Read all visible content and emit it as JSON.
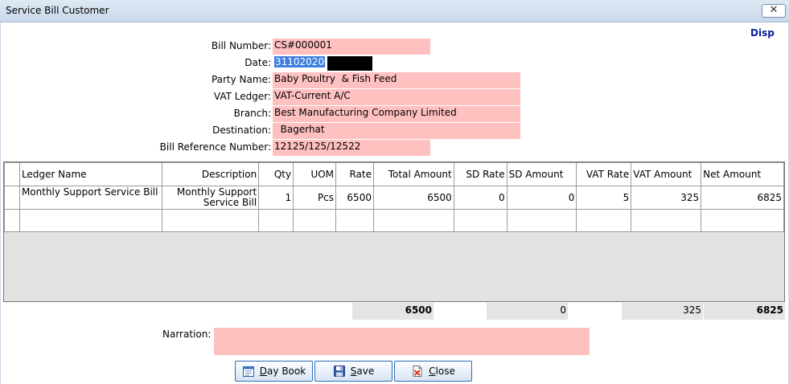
{
  "window": {
    "title": "Service Bill Customer",
    "close_glyph": "✕"
  },
  "disp": "Disp",
  "fields": {
    "bill_number": {
      "label": "Bill Number:",
      "value": "CS#000001"
    },
    "date": {
      "label": "Date:",
      "value": "31102020"
    },
    "party_name": {
      "label": "Party Name:",
      "value": "Baby Poultry  & Fish Feed"
    },
    "vat_ledger": {
      "label": "VAT Ledger:",
      "value": "VAT-Current A/C"
    },
    "branch": {
      "label": "Branch:",
      "value": "Best Manufacturing Company Limited"
    },
    "destination": {
      "label": "Destination:",
      "value": "  Bagerhat"
    },
    "bill_reference": {
      "label": "Bill Reference Number:",
      "value": "12125/125/12522"
    }
  },
  "grid": {
    "headers": [
      "Ledger Name",
      "Description",
      "Qty",
      "UOM",
      "Rate",
      "Total Amount",
      "SD Rate",
      "SD Amount",
      "VAT Rate",
      "VAT Amount",
      "Net Amount"
    ],
    "rows": [
      [
        "Monthly Support Service Bill",
        "Monthly Support Service Bill",
        "1",
        "Pcs",
        "6500",
        "6500",
        "0",
        "0",
        "5",
        "325",
        "6825"
      ]
    ]
  },
  "totals": {
    "total_amount": "6500",
    "sd_amount": "0",
    "vat_amount": "325",
    "net_amount": "6825"
  },
  "narration": {
    "label": "Narration:",
    "value": ""
  },
  "buttons": {
    "day_book": {
      "first": "D",
      "rest": "ay Book",
      "icon": "calendar-icon"
    },
    "save": {
      "first": "S",
      "rest": "ave",
      "icon": "floppy-disk-icon"
    },
    "close": {
      "first": "C",
      "rest": "lose",
      "icon": "close-document-icon"
    }
  },
  "colors": {
    "field_bg": "#ffc0c0",
    "disp": "#0a1e9c",
    "selection": "#3d7fe0"
  }
}
